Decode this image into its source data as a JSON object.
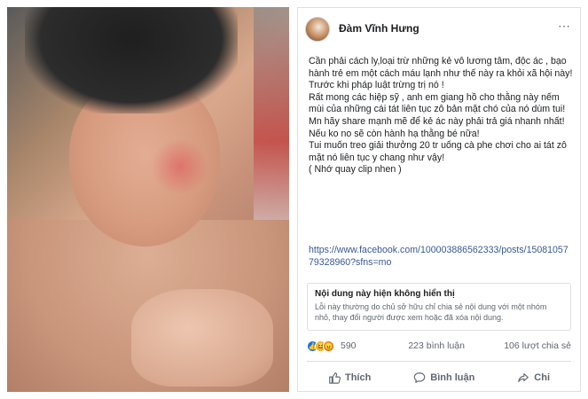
{
  "post": {
    "author": "Đàm Vĩnh Hưng",
    "more_icon": "⋯",
    "paragraphs": [
      "Cần phải cách ly,loại trừ những kẻ vô lương tâm, độc ác , bạo hành trẻ em một cách máu lạnh như thế này ra khỏi xã hội này!",
      "Trước khi pháp luật trừng trị nó !",
      "Rất mong các hiệp sỹ , anh em giang hồ cho thằng này nếm mùi của những cái tát liên tục zô bản mặt chó của nó dùm tui!",
      "Mn hãy share mạnh mẽ để kẻ ác này phải trả giá nhanh nhất! Nếu ko no sẽ còn hành hạ thằng bé nữa!",
      "Tui muốn treo giải thưởng 20 tr uống cà phe chơi cho ai tát zô mặt nó liên tục y chang như vậy!",
      "( Nhớ quay clip nhen )"
    ],
    "link": "https://www.facebook.com/100003886562333/posts/1508105779328960?sfns=mo",
    "notice": {
      "title": "Nội dung này hiện không hiển thị",
      "description": "Lỗi này thường do chủ sở hữu chỉ chia sẻ nội dung với một nhóm nhỏ, thay đổi người được xem hoặc đã xóa nội dung."
    },
    "stats": {
      "reactions": "590",
      "comments": "223 bình luận",
      "shares": "106 lượt chia sẻ"
    },
    "actions": {
      "like": "Thích",
      "comment": "Bình luận",
      "share": "Chi"
    },
    "icons": {
      "like": "thumbs-up-icon",
      "comment": "comment-bubble-icon",
      "share": "share-arrow-icon"
    }
  }
}
